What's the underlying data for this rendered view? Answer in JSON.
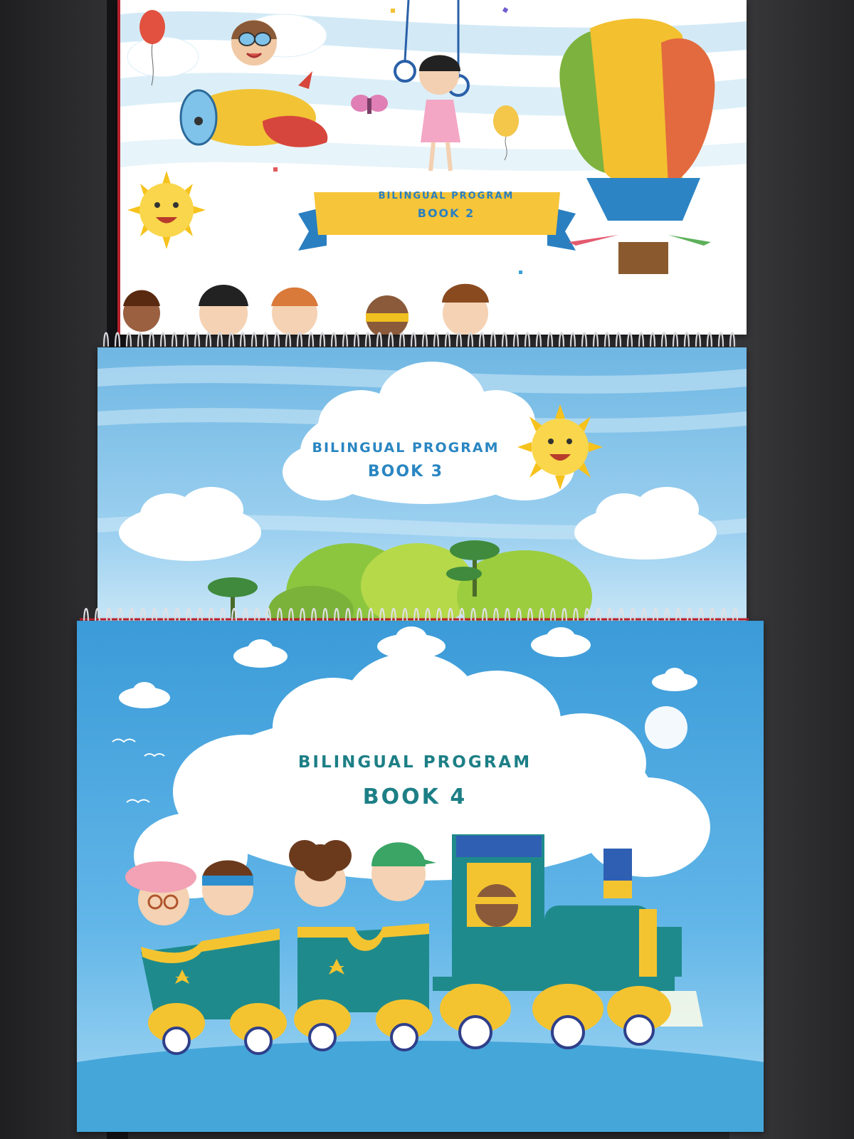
{
  "books": [
    {
      "title": "Bilingual Program",
      "book": "Book 2"
    },
    {
      "title": "Bilingual Program",
      "book": "Book 3"
    },
    {
      "title": "Bilingual Program",
      "book": "Book 4"
    }
  ],
  "colors": {
    "desk": "#2a2a2c",
    "banner_yellow": "#f6c53a",
    "banner_blue": "#2a7fc1",
    "title_blue": "#2a86c2",
    "title_teal": "#1d7f86",
    "sky_blue": "#62b6e8",
    "train_teal": "#1f8a8c",
    "train_yellow": "#f4c430"
  },
  "icons": [
    "balloon-icon",
    "airplane-icon",
    "sun-icon",
    "hot-air-balloon-icon",
    "cloud-icon",
    "tree-icon",
    "bird-icon",
    "train-icon",
    "spiral-binding-icon"
  ]
}
